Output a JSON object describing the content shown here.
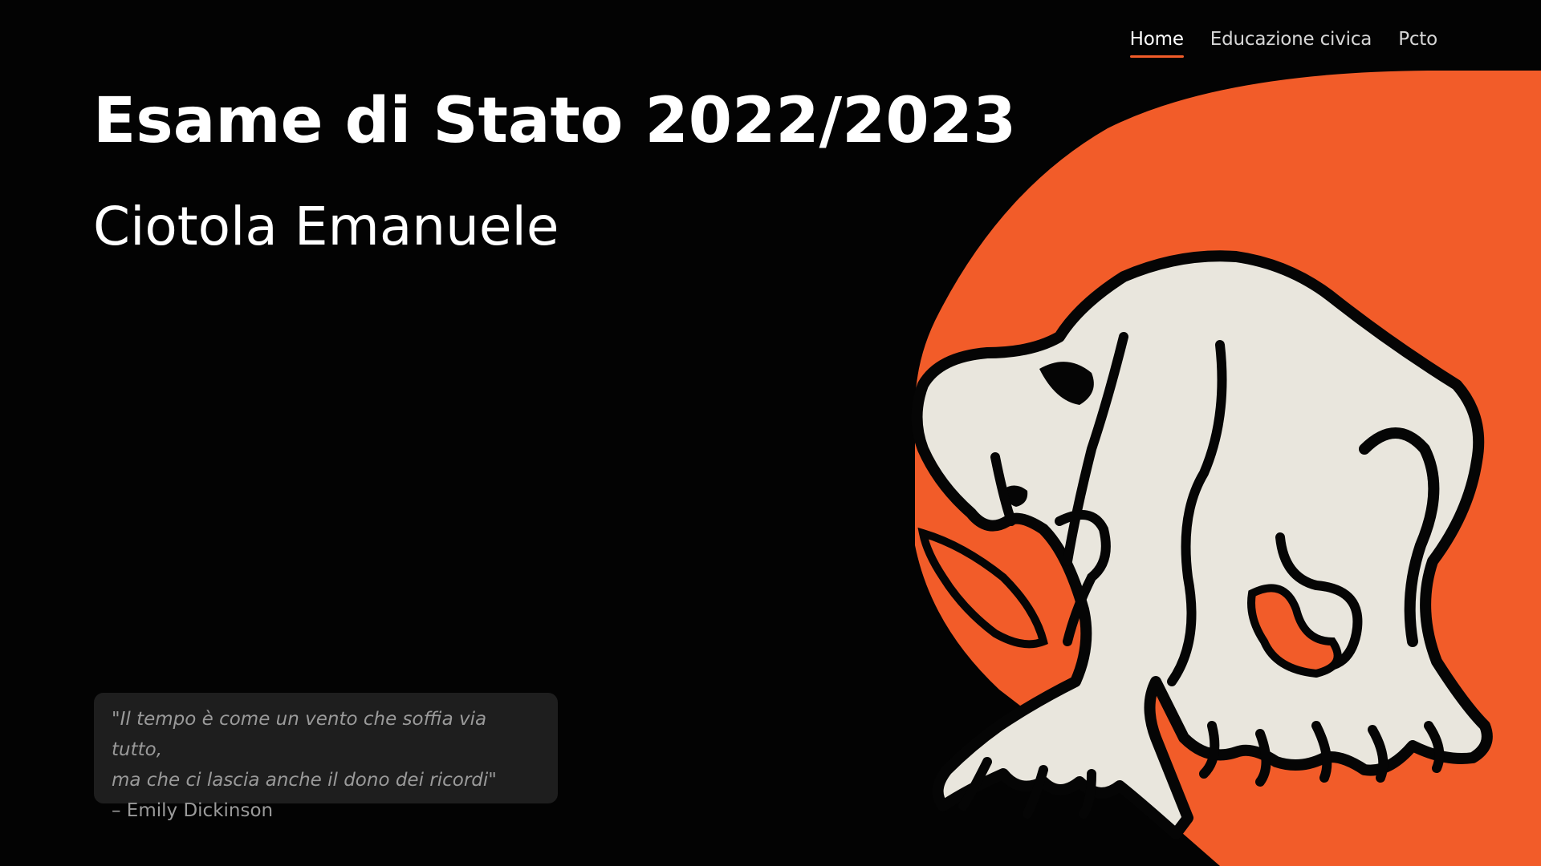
{
  "nav": {
    "items": [
      {
        "label": "Home",
        "active": true
      },
      {
        "label": "Educazione civica",
        "active": false
      },
      {
        "label": "Pcto",
        "active": false
      }
    ]
  },
  "hero": {
    "title": "Esame di Stato 2022/2023",
    "subtitle": "Ciotola Emanuele"
  },
  "quote": {
    "line1": "\"Il tempo è come un vento che soffia via tutto,",
    "line2": "ma che ci lascia anche il dono dei ricordi\"",
    "author": "– Emily Dickinson"
  },
  "illustration": {
    "subject": "crouching-figure-illustration",
    "colors": {
      "background": "#030303",
      "accent": "#f25c29",
      "figure": "#e9e6dd",
      "outline": "#050505"
    }
  }
}
